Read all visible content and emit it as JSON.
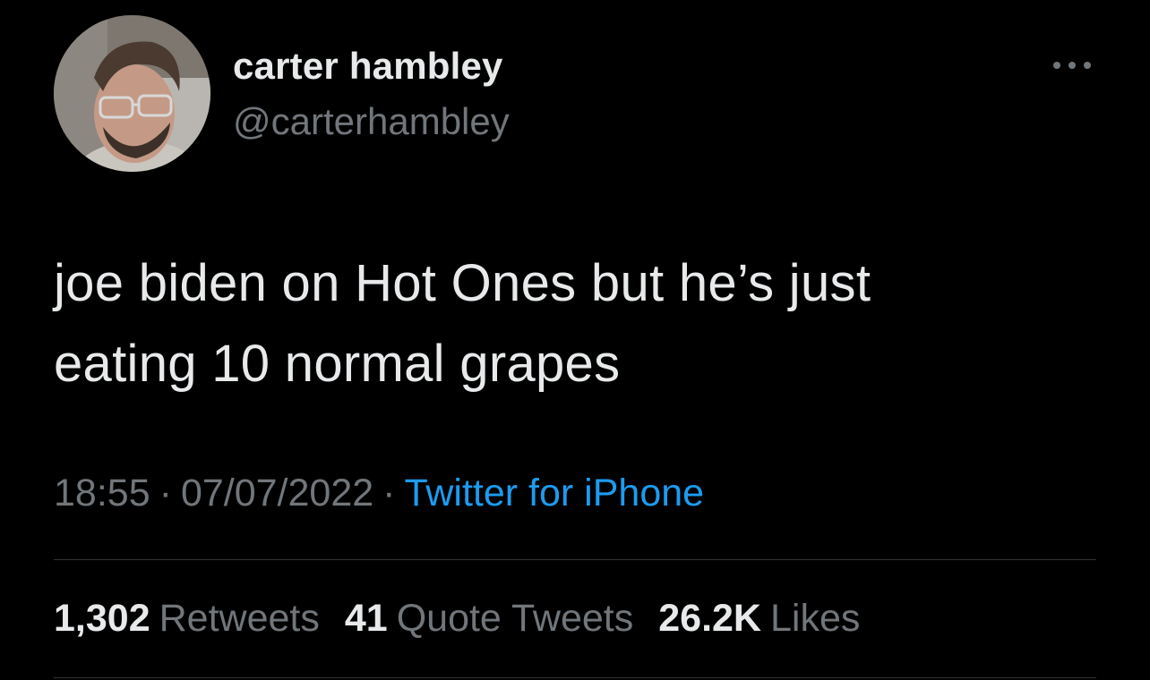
{
  "author": {
    "display_name": "carter hambley",
    "handle": "@carterhambley"
  },
  "tweet": {
    "text_lines": [
      "joe biden on Hot Ones but he’s just",
      "eating 10 normal grapes"
    ],
    "time": "18:55",
    "separator": "·",
    "date": "07/07/2022",
    "source": "Twitter for iPhone"
  },
  "stats": {
    "retweets_count": "1,302",
    "retweets_label": "Retweets",
    "quotes_count": "41",
    "quotes_label": "Quote Tweets",
    "likes_count": "26.2K",
    "likes_label": "Likes"
  },
  "icons": {
    "more": "more-horizontal-icon"
  },
  "colors": {
    "background": "#000000",
    "primary_text": "#e7e9ea",
    "secondary_text": "#71767b",
    "link": "#1d9bf0",
    "divider": "#2f3336"
  }
}
